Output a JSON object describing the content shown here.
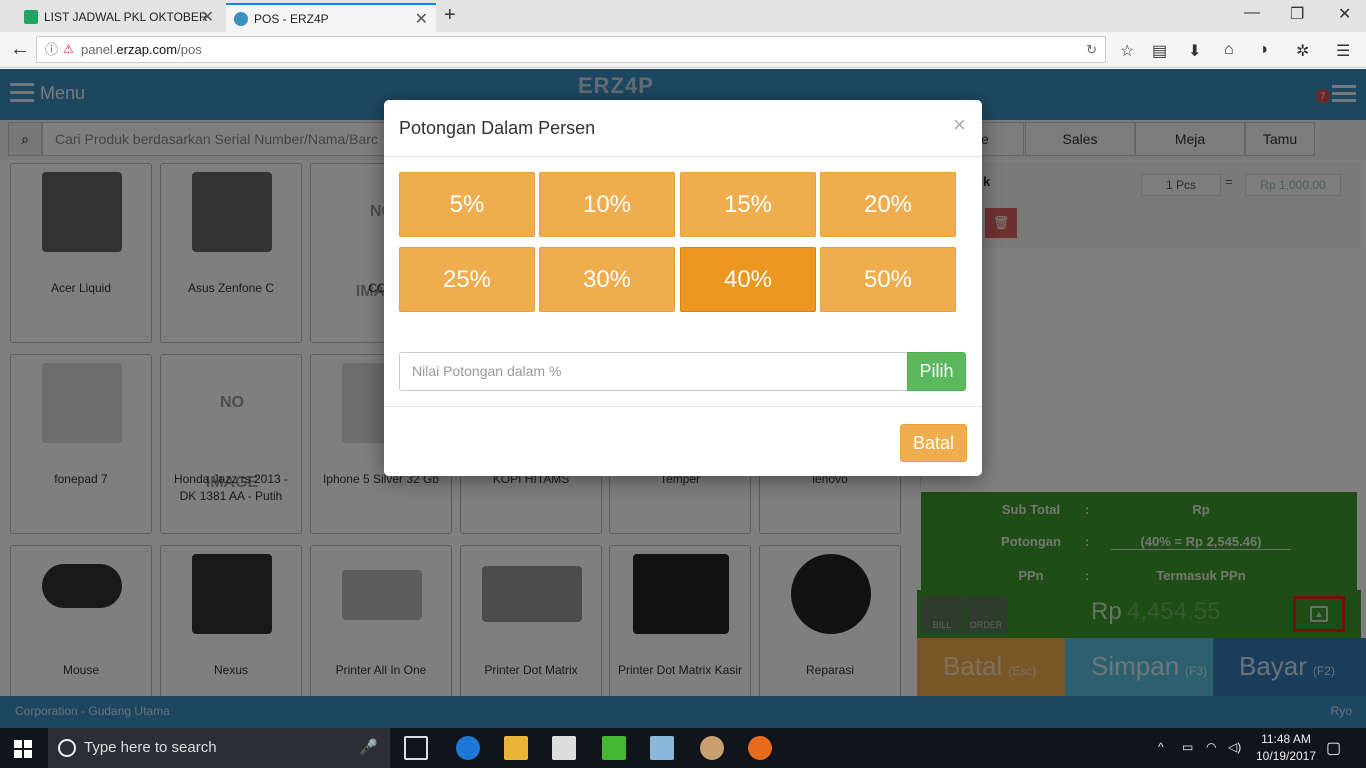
{
  "browser": {
    "tabs": [
      {
        "label": "LIST JADWAL PKL OKTOBER",
        "active": false
      },
      {
        "label": "POS - ERZ4P",
        "active": true
      }
    ],
    "url_prefix": "panel.",
    "url_domain": "erzap.com",
    "url_path": "/pos"
  },
  "app": {
    "menu_label": "Menu",
    "logo_text": "ERZ4P",
    "notification_count": "7",
    "search_placeholder": "Cari Produk berdasarkan Serial Number/Nama/Barc",
    "right_tabs": [
      "Sales",
      "Meja",
      "Tamu"
    ],
    "right_tab_partial": "e"
  },
  "products": [
    {
      "name": "Acer Liquid"
    },
    {
      "name": "Asus Zenfone C"
    },
    {
      "name": "CCS"
    },
    {
      "name": "fonepad 7"
    },
    {
      "name": "Honda Jazz rs 2013 - DK 1381 AA - Putih"
    },
    {
      "name": "Iphone 5 Silver 32 Gb"
    },
    {
      "name": "KOPI HITAMS"
    },
    {
      "name": "Temper"
    },
    {
      "name": "lenovo"
    },
    {
      "name": "Mouse"
    },
    {
      "name": "Nexus"
    },
    {
      "name": "Printer All In One"
    },
    {
      "name": "Printer Dot Matrix"
    },
    {
      "name": "Printer Dot Matrix Kasir"
    },
    {
      "name": "Reparasi"
    }
  ],
  "no_image_text": "NO IMAGE",
  "cart": {
    "item_partial": "k",
    "qty": "1 Pcs",
    "eq": "=",
    "price_blurred": "Rp 1,000.00"
  },
  "summary": {
    "subtotal_label": "Sub Total",
    "subtotal_value": "Rp",
    "potongan_label": "Potongan",
    "potongan_value": "(40% = Rp 2,545.46)",
    "ppn_label": "PPn",
    "ppn_value": "Termasuk PPn",
    "colon": ":",
    "total_currency": "Rp",
    "total_blurred": "4,454.55",
    "bill_label": "BILL",
    "order_label": "ORDER"
  },
  "actions": [
    {
      "label": "Batal",
      "key": "(Esc)",
      "color": "#f0ad4e"
    },
    {
      "label": "Simpan",
      "key": "(F3)",
      "color": "#5bc0de"
    },
    {
      "label": "Bayar",
      "key": "(F2)",
      "color": "#337ab7"
    }
  ],
  "footer": {
    "location": "Corporation - Gudang Utama",
    "user": "Ryo"
  },
  "modal": {
    "title": "Potongan Dalam Persen",
    "close_symbol": "×",
    "percent_options": [
      "5%",
      "10%",
      "15%",
      "20%",
      "25%",
      "30%",
      "40%",
      "50%"
    ],
    "selected_option": "40%",
    "input_placeholder": "Nilai Potongan dalam %",
    "pilih_label": "Pilih",
    "batal_label": "Batal"
  },
  "taskbar": {
    "search_placeholder": "Type here to search",
    "time": "11:48 AM",
    "date": "10/19/2017"
  },
  "colors": {
    "app_blue": "#3a8ec0",
    "warning": "#f0ad4e",
    "warning_active": "#ec971f",
    "success": "#5cb85c",
    "summary_green": "#3c9a2a",
    "highlight_red": "#ee1c1c"
  }
}
